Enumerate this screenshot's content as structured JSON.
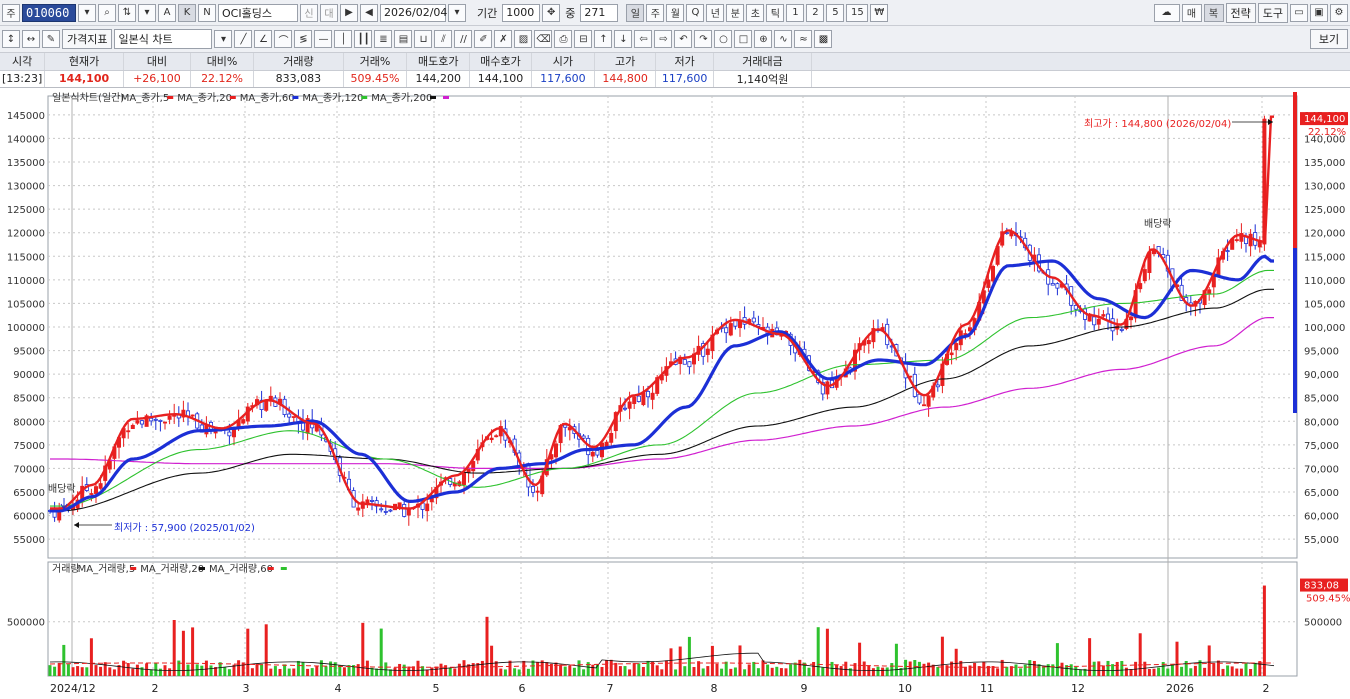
{
  "toolbar1": {
    "code_prefix": "주",
    "code": "010060",
    "mode_a": "A",
    "mode_k": "K",
    "mode_n": "N",
    "stock_name": "OCI홀딩스",
    "credit_badge": "신",
    "loan_badge": "대",
    "date": "2026/02/04",
    "period_label": "기간",
    "period_value": "1000",
    "count_label": "중",
    "count_value": "271",
    "periods": [
      "일",
      "주",
      "월",
      "Q",
      "년",
      "분",
      "초",
      "틱",
      "1",
      "2",
      "5",
      "15",
      "₩"
    ],
    "right_buttons": [
      "매",
      "복",
      "전략",
      "도구"
    ]
  },
  "toolbar2": {
    "indicator_button": "가격지표",
    "chart_type": "일본식 차트",
    "view_button": "보기"
  },
  "quote": {
    "headers": [
      "시각",
      "현재가",
      "대비",
      "대비%",
      "거래량",
      "거래%",
      "매도호가",
      "매수호가",
      "시가",
      "고가",
      "저가",
      "거래대금"
    ],
    "values": [
      "[13:23]",
      "144,100",
      "+26,100",
      "22.12%",
      "833,083",
      "509.45%",
      "144,200",
      "144,100",
      "117,600",
      "144,800",
      "117,600",
      "1,140억원"
    ]
  },
  "price_legend": {
    "title": "일본식차트(일간)",
    "items": [
      {
        "label": "MA_종가,5",
        "color": "#e82020"
      },
      {
        "label": "MA_종가,20",
        "color": "#e82020"
      },
      {
        "label": "MA_종가,60",
        "color": "#1c2fd6"
      },
      {
        "label": "MA_종가,120",
        "color": "#2ec22e"
      },
      {
        "label": "MA_종가,200",
        "color": "#111111"
      },
      {
        "label": "",
        "color": "#d020d0"
      }
    ]
  },
  "volume_legend": {
    "title": "거래량",
    "items": [
      {
        "label": "MA_거래량,5",
        "color": "#e82020"
      },
      {
        "label": "MA_거래량,20",
        "color": "#111111"
      },
      {
        "label": "MA_거래량,60",
        "color": "#e82020"
      },
      {
        "label": "",
        "color": "#2ec22e"
      }
    ]
  },
  "annotations": {
    "high": "최고가 : 144,800 (2026/02/04)",
    "low": "최저가 : 57,900 (2025/01/02)",
    "dividend1": "배당락",
    "dividend2": "배당락",
    "price_badge": "144,100",
    "price_pct": "22.12%",
    "vol_badge": "833,08",
    "vol_pct": "509.45%"
  },
  "chart_data": [
    {
      "type": "candlestick",
      "title": "일본식차트(일간)",
      "y_ticks": [
        55000,
        60000,
        65000,
        70000,
        75000,
        80000,
        85000,
        90000,
        95000,
        100000,
        105000,
        110000,
        115000,
        120000,
        125000,
        130000,
        135000,
        140000,
        145000
      ],
      "ylim": [
        51000,
        149000
      ],
      "x_ticks": [
        "2024/12",
        "2",
        "3",
        "4",
        "5",
        "6",
        "7",
        "8",
        "9",
        "10",
        "11",
        "12",
        "2026",
        "2"
      ],
      "high": 144800,
      "low": 57900,
      "last": 144100,
      "close_series": [
        [
          "2024/12",
          61000
        ],
        [
          "2025/01",
          66000
        ],
        [
          "2025/01",
          80000
        ],
        [
          "2025/02",
          81000
        ],
        [
          "2025/02",
          78000
        ],
        [
          "2025/03",
          84000
        ],
        [
          "2025/03",
          79000
        ],
        [
          "2025/04",
          62000
        ],
        [
          "2025/04",
          61000
        ],
        [
          "2025/05",
          68000
        ],
        [
          "2025/05",
          78000
        ],
        [
          "2025/06",
          66000
        ],
        [
          "2025/06",
          79000
        ],
        [
          "2025/06",
          74000
        ],
        [
          "2025/07",
          85000
        ],
        [
          "2025/07",
          93000
        ],
        [
          "2025/08",
          101000
        ],
        [
          "2025/08",
          98000
        ],
        [
          "2025/09",
          87000
        ],
        [
          "2025/09",
          99000
        ],
        [
          "2025/10",
          85000
        ],
        [
          "2025/10",
          100000
        ],
        [
          "2025/11",
          120000
        ],
        [
          "2025/11",
          110000
        ],
        [
          "2025/12",
          102000
        ],
        [
          "2025/12",
          100000
        ],
        [
          "2025/12",
          116000
        ],
        [
          "2026/01",
          104000
        ],
        [
          "2026/01",
          119000
        ],
        [
          "2026/02",
          117600
        ],
        [
          "2026/02",
          144100
        ]
      ],
      "ma60_series": [
        [
          "2024/12",
          61000
        ],
        [
          "2025/01",
          64000
        ],
        [
          "2025/01",
          72000
        ],
        [
          "2025/02",
          78000
        ],
        [
          "2025/03",
          79000
        ],
        [
          "2025/03",
          80000
        ],
        [
          "2025/04",
          73000
        ],
        [
          "2025/04",
          63000
        ],
        [
          "2025/05",
          65000
        ],
        [
          "2025/05",
          70000
        ],
        [
          "2025/06",
          71000
        ],
        [
          "2025/06",
          74000
        ],
        [
          "2025/07",
          75000
        ],
        [
          "2025/07",
          83000
        ],
        [
          "2025/08",
          96000
        ],
        [
          "2025/08",
          99000
        ],
        [
          "2025/09",
          89000
        ],
        [
          "2025/09",
          93000
        ],
        [
          "2025/10",
          92000
        ],
        [
          "2025/10",
          98000
        ],
        [
          "2025/11",
          113000
        ],
        [
          "2025/11",
          114000
        ],
        [
          "2025/12",
          106000
        ],
        [
          "2025/12",
          102000
        ],
        [
          "2026/01",
          112000
        ],
        [
          "2026/01",
          110000
        ],
        [
          "2026/02",
          115000
        ],
        [
          "2026/02",
          114000
        ]
      ],
      "ma120_series": [
        [
          "2024/12",
          62000
        ],
        [
          "2025/02",
          74000
        ],
        [
          "2025/03",
          78000
        ],
        [
          "2025/04",
          72000
        ],
        [
          "2025/05",
          66000
        ],
        [
          "2025/06",
          70000
        ],
        [
          "2025/07",
          75000
        ],
        [
          "2025/08",
          86000
        ],
        [
          "2025/09",
          92000
        ],
        [
          "2025/10",
          93000
        ],
        [
          "2025/11",
          102000
        ],
        [
          "2025/12",
          105000
        ],
        [
          "2026/01",
          107000
        ],
        [
          "2026/02",
          112000
        ]
      ],
      "ma200_series": [
        [
          "2024/12",
          61000
        ],
        [
          "2025/02",
          69000
        ],
        [
          "2025/03",
          73000
        ],
        [
          "2025/04",
          72000
        ],
        [
          "2025/05",
          69000
        ],
        [
          "2025/06",
          70000
        ],
        [
          "2025/07",
          73000
        ],
        [
          "2025/08",
          79000
        ],
        [
          "2025/09",
          83000
        ],
        [
          "2025/10",
          89000
        ],
        [
          "2025/11",
          96000
        ],
        [
          "2025/12",
          100000
        ],
        [
          "2026/01",
          104000
        ],
        [
          "2026/02",
          108000
        ]
      ],
      "magenta_series": [
        [
          "2024/12",
          72000
        ],
        [
          "2025/02",
          71000
        ],
        [
          "2025/03",
          71000
        ],
        [
          "2025/04",
          71000
        ],
        [
          "2025/05",
          70000
        ],
        [
          "2025/06",
          70000
        ],
        [
          "2025/07",
          72000
        ],
        [
          "2025/08",
          76000
        ],
        [
          "2025/09",
          79000
        ],
        [
          "2025/10",
          83000
        ],
        [
          "2025/11",
          87000
        ],
        [
          "2025/12",
          91000
        ],
        [
          "2026/01",
          96000
        ],
        [
          "2026/02",
          102000
        ]
      ]
    },
    {
      "type": "bar",
      "title": "거래량",
      "y_ticks": [
        500000
      ],
      "ylim": [
        0,
        1050000
      ],
      "last": 833083
    }
  ]
}
